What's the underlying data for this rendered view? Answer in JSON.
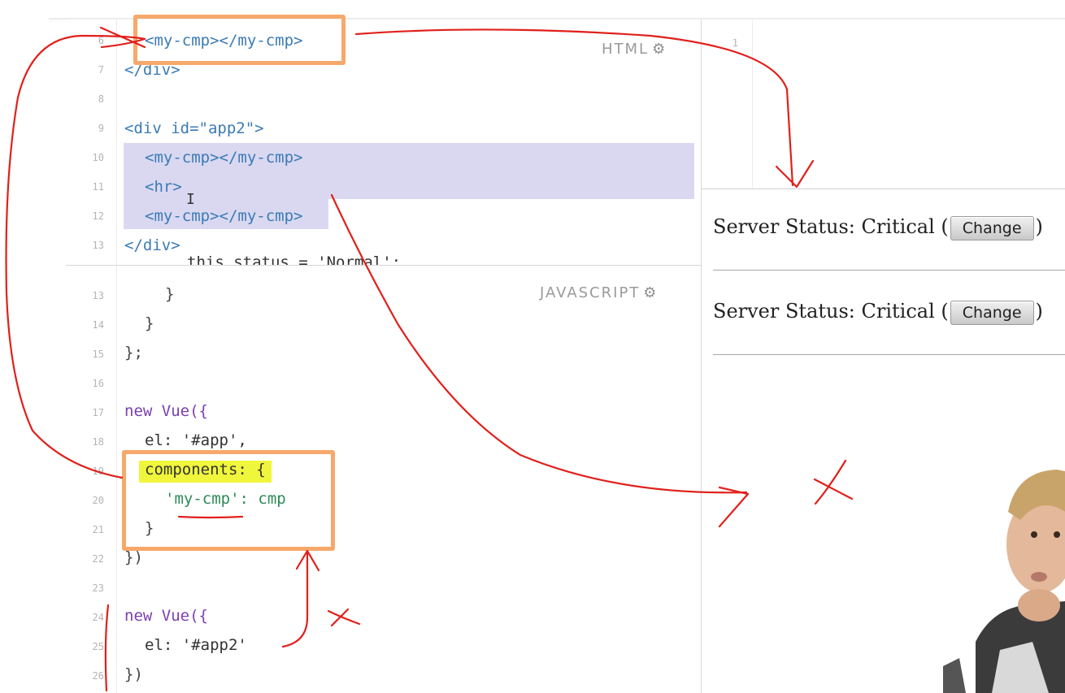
{
  "html_pane": {
    "label": "HTML",
    "icon": "gear-icon",
    "lines": [
      {
        "n": "6",
        "text": "<my-cmp></my-cmp>"
      },
      {
        "n": "7",
        "text": "</div>"
      },
      {
        "n": "8",
        "text": ""
      },
      {
        "n": "9",
        "text": "<div id=\"app2\">"
      },
      {
        "n": "10",
        "text": "<my-cmp></my-cmp>"
      },
      {
        "n": "11",
        "text": "<hr>"
      },
      {
        "n": "12",
        "text": "<my-cmp></my-cmp>"
      },
      {
        "n": "13",
        "text": "</div>"
      }
    ]
  },
  "js_pane": {
    "label": "JAVASCRIPT",
    "icon": "gear-icon",
    "partial_line": "this.status = 'Normal';",
    "lines": [
      {
        "n": "13",
        "text": "}"
      },
      {
        "n": "14",
        "text": "}"
      },
      {
        "n": "15",
        "text": "};"
      },
      {
        "n": "16",
        "text": ""
      },
      {
        "n": "17",
        "text": "new Vue({"
      },
      {
        "n": "18",
        "text": "el: '#app',"
      },
      {
        "n": "19",
        "text": "components: {"
      },
      {
        "n": "20",
        "text": "'my-cmp': cmp"
      },
      {
        "n": "21",
        "text": "}"
      },
      {
        "n": "22",
        "text": "})"
      },
      {
        "n": "23",
        "text": ""
      },
      {
        "n": "24",
        "text": "new Vue({"
      },
      {
        "n": "25",
        "text": "el: '#app2'"
      },
      {
        "n": "26",
        "text": "})"
      }
    ]
  },
  "css_pane": {
    "lines": [
      {
        "n": "1"
      }
    ]
  },
  "output": {
    "rows": [
      {
        "prefix": "Server Status: Critical (",
        "button": "Change",
        "suffix": ")"
      },
      {
        "prefix": "Server Status: Critical (",
        "button": "Change",
        "suffix": ")"
      }
    ]
  },
  "colors": {
    "annotation_box": "#f7a86b",
    "annotation_ink": "#e0201b",
    "selection": "#dad8f1",
    "highlighter": "#f0f63b"
  }
}
